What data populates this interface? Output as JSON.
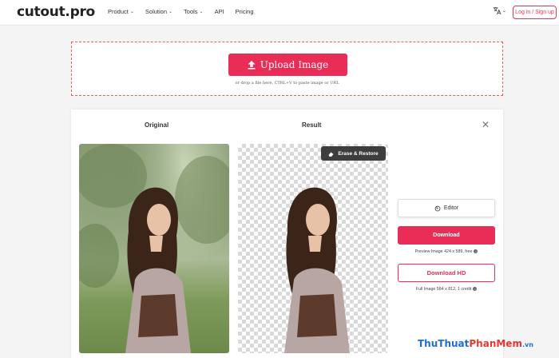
{
  "header": {
    "logo": "cutout.pro",
    "nav": [
      {
        "label": "Product",
        "dropdown": true
      },
      {
        "label": "Solution",
        "dropdown": true
      },
      {
        "label": "Tools",
        "dropdown": true
      },
      {
        "label": "API",
        "dropdown": false
      },
      {
        "label": "Pricing",
        "dropdown": false
      }
    ],
    "language_icon": "translate-icon",
    "login_label": "Log in / Sign up"
  },
  "upload": {
    "button_label": "Upload Image",
    "hint": "or drop a file here, CTRL+V to paste image or URL"
  },
  "panel": {
    "original_title": "Original",
    "result_title": "Result",
    "erase_restore_label": "Erase & Restore",
    "editor_label": "Editor",
    "download_label": "Download",
    "preview_info": "Preview Image 424 x 589, free",
    "download_hd_label": "Download HD",
    "full_info": "Full Image 584 x 812, 1 credit"
  },
  "watermark": {
    "part1": "ThuThuat",
    "part2": "PhanMem",
    "part3": ".vn"
  },
  "colors": {
    "accent": "#e92d57",
    "dashed_border": "#ef5a5a",
    "erase_bg": "#3d3d3d"
  }
}
